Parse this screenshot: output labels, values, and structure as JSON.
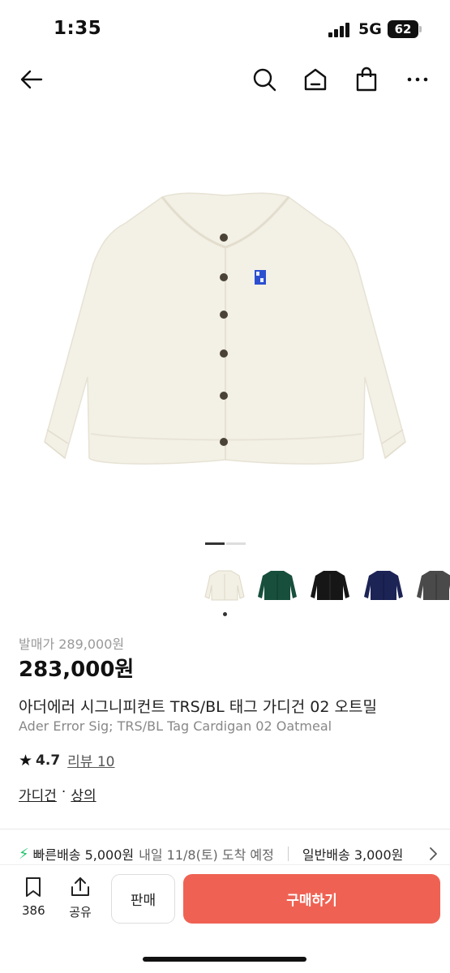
{
  "status_bar": {
    "time": "1:35",
    "network": "5G",
    "battery": "62"
  },
  "nav": {
    "back_icon": "arrow-left-icon",
    "search_icon": "search-icon",
    "home_icon": "home-icon",
    "bag_icon": "shopping-bag-icon",
    "more_icon": "more-horizontal-icon"
  },
  "gallery": {
    "current_page": 1,
    "total_pages": 2,
    "active_color": "#333333",
    "inactive_color": "#dddddd"
  },
  "color_options": [
    {
      "name": "oatmeal",
      "color": "#f2efe4",
      "selected": true
    },
    {
      "name": "green",
      "color": "#174f3c",
      "selected": false
    },
    {
      "name": "black",
      "color": "#161616",
      "selected": false
    },
    {
      "name": "navy",
      "color": "#1c2355",
      "selected": false
    },
    {
      "name": "charcoal",
      "color": "#4a4a4a",
      "selected": false
    }
  ],
  "product": {
    "original_price": "발매가 289,000원",
    "price": "283,000원",
    "title_ko": "아더에러 시그니피컨트 TRS/BL 태그 가디건 02 오트밀",
    "title_en": "Ader Error Sig; TRS/BL Tag Cardigan 02 Oatmeal",
    "rating": "4.7",
    "review_label": "리뷰 10",
    "category_1": "가디건",
    "category_sep": "·",
    "category_2": "상의"
  },
  "shipping": {
    "fast": "빠른배송 5,000원",
    "fast_date": "내일 11/8(토) 도착 예정",
    "normal": "일반배송 3,000원"
  },
  "bottom_bar": {
    "bookmark_count": "386",
    "share_label": "공유",
    "sell_label": "판매",
    "buy_label": "구매하기",
    "buy_color": "#ef6253"
  }
}
